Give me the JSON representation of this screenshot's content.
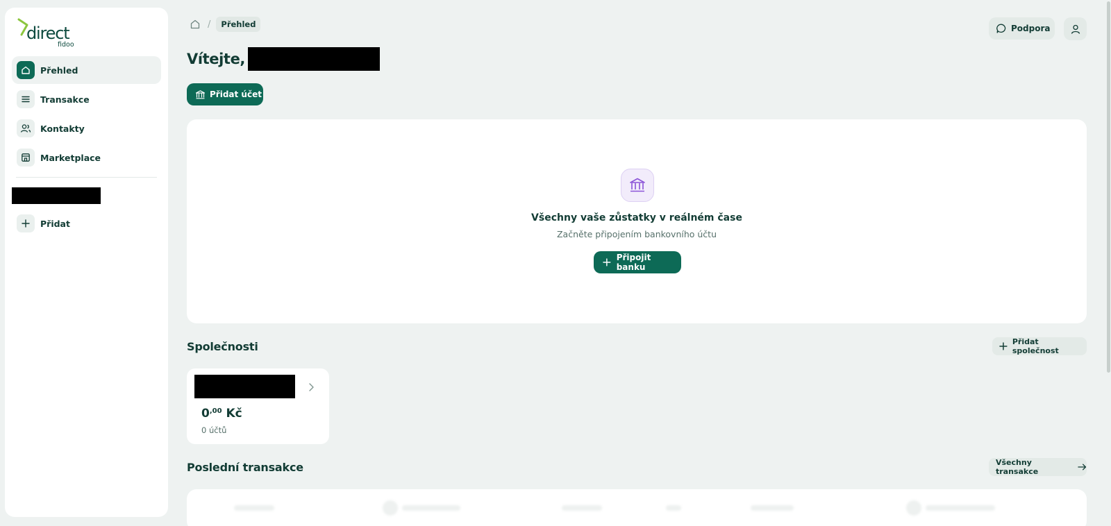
{
  "brand": {
    "name": "direct",
    "sub": "fidoo",
    "accent": "#0d6a56",
    "logo_mark_color": "#8cc63f"
  },
  "sidebar": {
    "items": [
      {
        "label": "Přehled",
        "icon": "home-icon",
        "active": true
      },
      {
        "label": "Transakce",
        "icon": "list-icon"
      },
      {
        "label": "Kontakty",
        "icon": "contacts-icon"
      },
      {
        "label": "Marketplace",
        "icon": "marketplace-icon"
      }
    ],
    "add_label": "Přidat"
  },
  "breadcrumb": {
    "current": "Přehled"
  },
  "header": {
    "support_label": "Podpora"
  },
  "welcome": {
    "title": "Vítejte,"
  },
  "actions": {
    "add_account_label": "Přidat účet"
  },
  "empty_state": {
    "title": "Všechny vaše zůstatky v reálném čase",
    "subtitle": "Začněte připojením bankovního účtu",
    "button_label": "Připojit banku"
  },
  "companies": {
    "title": "Společnosti",
    "add_label": "Přidat společnost",
    "card": {
      "balance_main": "0",
      "balance_decimal": ",00",
      "currency": "Kč",
      "accounts": "0 účtů"
    }
  },
  "transactions": {
    "title": "Poslední transakce",
    "all_label": "Všechny transakce"
  }
}
